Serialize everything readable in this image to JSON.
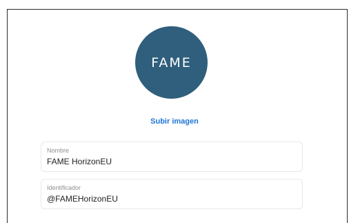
{
  "profile": {
    "avatar_text": "FAME",
    "upload_label": "Subir imagen",
    "fields": [
      {
        "label": "Nombre",
        "value": "FAME HorizonEU"
      },
      {
        "label": "Identificador",
        "value": "@FAMEHorizonEU"
      }
    ]
  },
  "colors": {
    "avatar_bg": "#2f5f7c",
    "link": "#1f74d6"
  }
}
